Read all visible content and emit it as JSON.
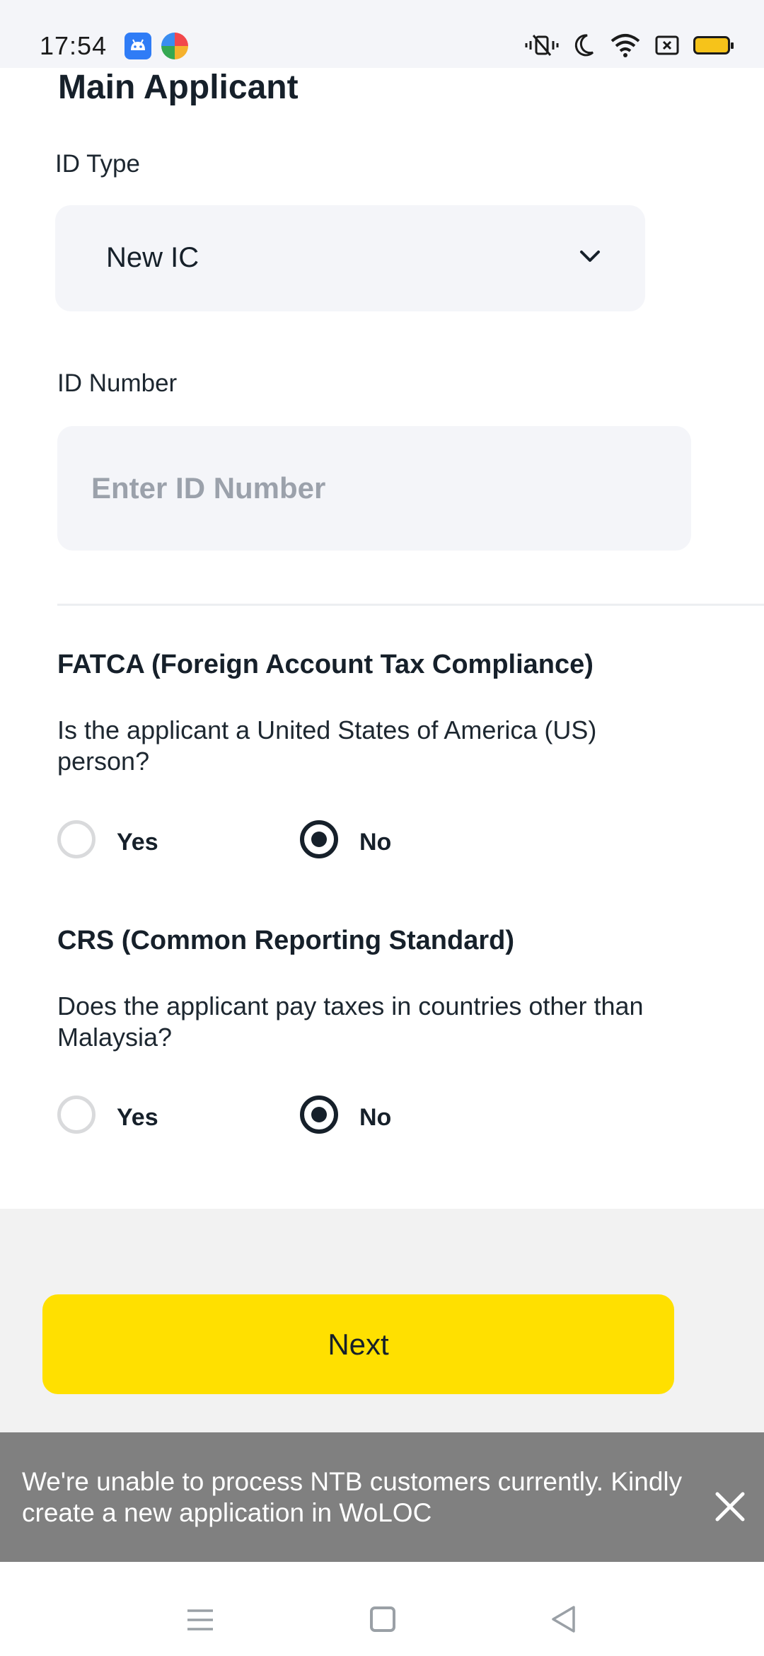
{
  "status_bar": {
    "time": "17:54",
    "left_icons": [
      "android-app-icon",
      "colorful-app-icon"
    ],
    "right_icons": [
      "vibrate-icon",
      "moon-icon",
      "wifi-icon",
      "screen-icon",
      "battery-icon"
    ],
    "battery_color": "#f6c31a"
  },
  "page": {
    "title": "Main Applicant"
  },
  "id_type": {
    "label": "ID Type",
    "value": "New IC"
  },
  "id_number": {
    "label": "ID Number",
    "placeholder": "Enter ID Number",
    "value": ""
  },
  "fatca": {
    "title": "FATCA (Foreign Account Tax Compliance)",
    "question": "Is the applicant a United States of America (US) person?",
    "options": [
      {
        "label": "Yes",
        "selected": false
      },
      {
        "label": "No",
        "selected": true
      }
    ]
  },
  "crs": {
    "title": "CRS (Common Reporting Standard)",
    "question": "Does the applicant pay taxes in countries other than Malaysia?",
    "options": [
      {
        "label": "Yes",
        "selected": false
      },
      {
        "label": "No",
        "selected": true
      }
    ]
  },
  "actions": {
    "next_label": "Next",
    "next_color": "#ffe000"
  },
  "toast": {
    "message": "We're unable to process NTB customers currently. Kindly create a new application in WoLOC",
    "background": "#808080"
  },
  "nav_bar": {
    "buttons": [
      "menu-icon",
      "home-icon",
      "back-icon"
    ]
  }
}
